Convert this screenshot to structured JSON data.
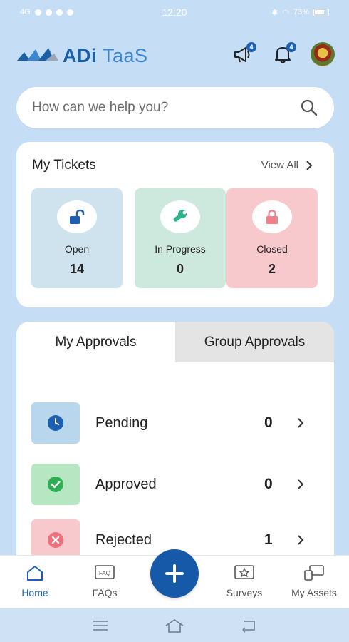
{
  "status_bar": {
    "time": "12:20",
    "left_text": "4G",
    "battery": "73%",
    "battery_level": 0.73
  },
  "app": {
    "brand_bold": "ADi",
    "brand_light": "TaaS",
    "announcements_count": "4",
    "notifications_count": "4"
  },
  "search": {
    "placeholder": "How can we help you?"
  },
  "tickets": {
    "title": "My Tickets",
    "view_all": "View All",
    "tiles": [
      {
        "label": "Open",
        "count": "14",
        "icon": "unlock-icon",
        "color": "#cfe3ef"
      },
      {
        "label": "In Progress",
        "count": "0",
        "icon": "wrench-icon",
        "color": "#cde9dd"
      },
      {
        "label": "Closed",
        "count": "2",
        "icon": "lock-icon",
        "color": "#f8c9cc"
      }
    ]
  },
  "approvals": {
    "tabs": [
      {
        "label": "My Approvals",
        "active": true
      },
      {
        "label": "Group Approvals",
        "active": false
      }
    ],
    "rows": [
      {
        "label": "Pending",
        "count": "0",
        "icon": "clock-icon",
        "color": "#b9d7ec"
      },
      {
        "label": "Approved",
        "count": "0",
        "icon": "check-circle-icon",
        "color": "#b6e7c2"
      },
      {
        "label": "Rejected",
        "count": "1",
        "icon": "x-circle-icon",
        "color": "#f8c9cc"
      }
    ]
  },
  "bottom_nav": {
    "items": [
      {
        "label": "Home",
        "icon": "home-icon",
        "active": true
      },
      {
        "label": "FAQs",
        "icon": "faq-icon",
        "active": false
      },
      {
        "label": "Surveys",
        "icon": "survey-icon",
        "active": false
      },
      {
        "label": "My Assets",
        "icon": "assets-icon",
        "active": false
      }
    ],
    "fab_icon": "plus-icon",
    "fab_badge": "FAQ"
  },
  "colors": {
    "background": "#c6ddf6",
    "brand": "#1b5fa8",
    "accent": "#1559a8"
  }
}
